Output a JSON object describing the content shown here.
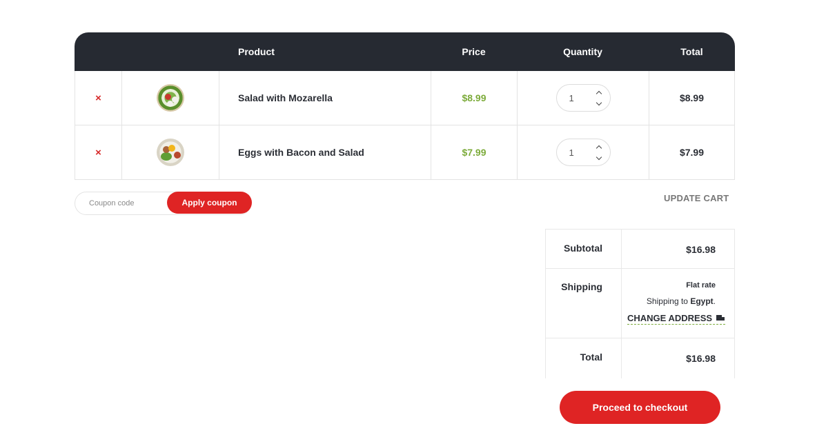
{
  "table": {
    "headers": {
      "product": "Product",
      "price": "Price",
      "quantity": "Quantity",
      "total": "Total"
    },
    "items": [
      {
        "remove": "×",
        "name": "Salad with Mozarella",
        "price": "$8.99",
        "quantity": "1",
        "total": "$8.99",
        "image_icon": "salad-bowl-image"
      },
      {
        "remove": "×",
        "name": "Eggs with Bacon and Salad",
        "price": "$7.99",
        "quantity": "1",
        "total": "$7.99",
        "image_icon": "eggs-bacon-plate-image"
      }
    ]
  },
  "coupon": {
    "placeholder": "Coupon code",
    "apply_label": "Apply coupon"
  },
  "update_cart_label": "UPDATE CART",
  "totals": {
    "subtotal_label": "Subtotal",
    "subtotal_value": "$16.98",
    "shipping_label": "Shipping",
    "shipping_method": "Flat rate",
    "shipping_to_prefix": "Shipping to",
    "shipping_country": "Egypt",
    "shipping_to_suffix": ".",
    "change_address_label": "CHANGE ADDRESS",
    "total_label": "Total",
    "total_value": "$16.98"
  },
  "checkout_label": "Proceed to checkout",
  "colors": {
    "accent_red": "#df2424",
    "price_green": "#7cab3a",
    "header_dark": "#262a32"
  }
}
